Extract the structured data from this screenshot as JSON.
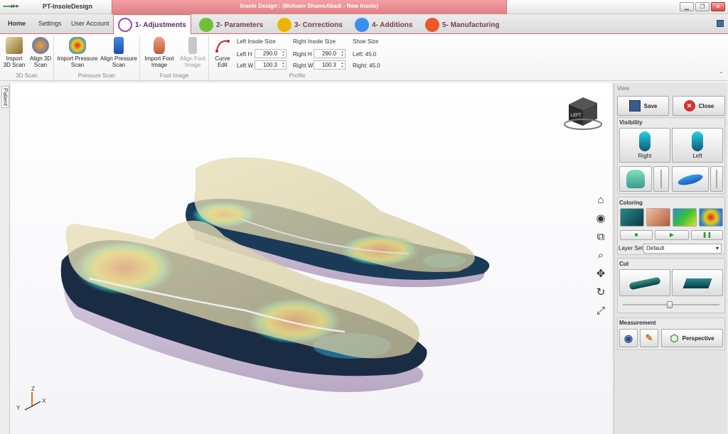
{
  "titlebar": {
    "app_title": "PT-InsoleDesign",
    "context_title": "Insole Design : (Mohsen ShamsAbadi - New Insole)"
  },
  "tabs": {
    "home": "Home",
    "settings": "Settings",
    "user_account": "User Account",
    "workflow": [
      {
        "label": "1- Adjustments",
        "color": "#a04ab0"
      },
      {
        "label": "2- Parameters",
        "color": "#6fbf3a"
      },
      {
        "label": "3- Corrections",
        "color": "#f0b400"
      },
      {
        "label": "4- Additions",
        "color": "#3a8ff0"
      },
      {
        "label": "5- Manufacturing",
        "color": "#e85a2a"
      }
    ]
  },
  "ribbon": {
    "scan3d": {
      "import_label": "Import 3D Scan",
      "align_label": "Align 3D Scan",
      "group_label": "3D Scan"
    },
    "pressure": {
      "import_label": "Import Pressure Scan",
      "align_label": "Align Pressure Scan",
      "group_label": "Pressure Scan"
    },
    "foot_image": {
      "import_label": "Import Foot Image",
      "align_label": "Align Foot Image",
      "group_label": "Foot Image"
    },
    "profile": {
      "curve_edit_label": "Curve Edit",
      "left_size_title": "Left Insole Size",
      "right_size_title": "Right Insole Size",
      "shoe_size_title": "Shoe Size",
      "left_h_label": "Left H",
      "left_h_value": "290.0",
      "left_w_label": "Left W",
      "left_w_value": "100.3",
      "right_h_label": "Right H",
      "right_h_value": "290.0",
      "right_w_label": "Right W",
      "right_w_value": "100.3",
      "shoe_left": "Left:  45.0",
      "shoe_right": "Right: 45.0",
      "group_label": "Profile"
    }
  },
  "side": {
    "patient_tab": "Patient"
  },
  "viewport": {
    "cube_face": "LEFT",
    "axis_z": "Z",
    "axis_y": "Y",
    "axis_x": "X"
  },
  "panel": {
    "title": "View",
    "save_label": "Save",
    "close_label": "Close",
    "visibility_title": "Visibility",
    "right_label": "Right",
    "left_label": "Left",
    "coloring_title": "Coloring",
    "layer_set_label": "Layer Set",
    "layer_set_value": "Default",
    "cut_title": "Cut",
    "measurement_title": "Measurement",
    "perspective_label": "Perspective"
  },
  "colors": {
    "context_accent": "#e07f86",
    "heatmap_hot": "#d41a1a",
    "insole_base": "#1f2a3a"
  }
}
